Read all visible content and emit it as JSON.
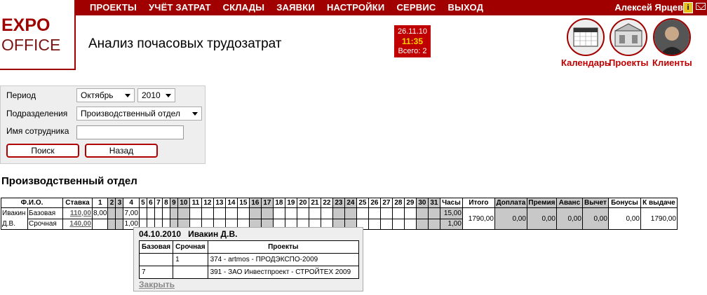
{
  "logo": {
    "line1": "EXPO",
    "line2": "OFFICE"
  },
  "menu": [
    "ПРОЕКТЫ",
    "УЧЁТ ЗАТРАТ",
    "СКЛАДЫ",
    "ЗАЯВКИ",
    "НАСТРОЙКИ",
    "СЕРВИС",
    "ВЫХОД"
  ],
  "user": {
    "name": "Алексей Ярцев",
    "info_icon": "info-icon",
    "mail_icon": "mail-icon"
  },
  "page_title": "Анализ почасовых трудозатрат",
  "datebox": {
    "date": "26.11.10",
    "time": "11:35",
    "total": "Всего: 2"
  },
  "shortcuts": [
    "Календарь",
    "Проекты",
    "Клиенты"
  ],
  "filter": {
    "period_label": "Период",
    "month": "Октябрь",
    "year": "2010",
    "division_label": "Подразделения",
    "division": "Производственный отдел",
    "employee_label": "Имя сотрудника",
    "employee_value": "",
    "search_button": "Поиск",
    "back_button": "Назад"
  },
  "department_title": "Производственный отдел",
  "table": {
    "headers": {
      "fio": "Ф.И.О.",
      "rate": "Ставка",
      "hours": "Часы",
      "total": "Итого",
      "extra": "Доплата",
      "bonus_prem": "Премия",
      "advance": "Аванс",
      "deduction": "Вычет",
      "bonuses": "Бонусы",
      "payout": "К выдаче"
    },
    "days": [
      "1",
      "2",
      "3",
      "4",
      "5",
      "6",
      "7",
      "8",
      "9",
      "10",
      "11",
      "12",
      "13",
      "14",
      "15",
      "16",
      "17",
      "18",
      "19",
      "20",
      "21",
      "22",
      "23",
      "24",
      "25",
      "26",
      "27",
      "28",
      "29",
      "30",
      "31"
    ],
    "weekend_days": [
      "2",
      "3",
      "9",
      "10",
      "16",
      "17",
      "23",
      "24",
      "30",
      "31"
    ],
    "employee": {
      "name": "Ивакин Д.В.",
      "rows": [
        {
          "type": "Базовая",
          "rate": "110,00",
          "cells": {
            "1": "8,00",
            "4": "7,00"
          },
          "hours": "15,00"
        },
        {
          "type": "Срочная",
          "rate": "140,00",
          "cells": {
            "4": "1,00"
          },
          "hours": "1,00"
        }
      ],
      "total": "1790,00",
      "extra": "0,00",
      "bonus_prem": "0,00",
      "advance": "0,00",
      "deduction": "0,00",
      "bonuses": "0,00",
      "payout": "1790,00"
    }
  },
  "popup": {
    "date": "04.10.2010",
    "name": "Ивакин Д.В.",
    "headers": [
      "Базовая",
      "Срочная",
      "Проекты"
    ],
    "rows": [
      {
        "base": "",
        "urgent": "1",
        "project": "374 - artmos - ПРОДЭКСПО-2009"
      },
      {
        "base": "7",
        "urgent": "",
        "project": "391 - ЗАО Инвестпроект - СТРОЙТЕХ 2009"
      }
    ],
    "close": "Закрыть"
  },
  "colors": {
    "brand": "#a00000",
    "weekend": "#c8c8c8",
    "time": "#ffd400"
  }
}
